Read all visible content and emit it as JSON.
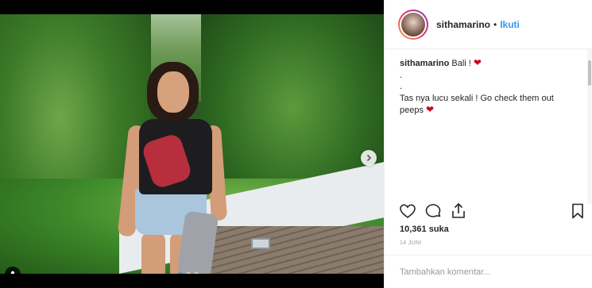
{
  "post": {
    "username": "sithamarino",
    "separator": "•",
    "follow_label": "Ikuti",
    "caption_user": "sithamarino",
    "caption_lines": [
      "Bali !",
      ".",
      ".",
      "Tas nya lucu sekali ! Go check them out peeps"
    ],
    "likes": "10,361 suka",
    "date": "14 JUNI",
    "comment_placeholder": "Tambahkan komentar..."
  },
  "carousel": {
    "total": 3,
    "active": 1
  },
  "icons": {
    "heart_caption": "heart-icon",
    "like": "heart-outline-icon",
    "comment": "comment-icon",
    "share": "share-icon",
    "save": "bookmark-icon",
    "next": "chevron-right-icon",
    "tag": "user-tag-icon"
  },
  "colors": {
    "accent": "#3897f0",
    "heart": "#d0021b",
    "text": "#262626",
    "muted": "#999999"
  }
}
